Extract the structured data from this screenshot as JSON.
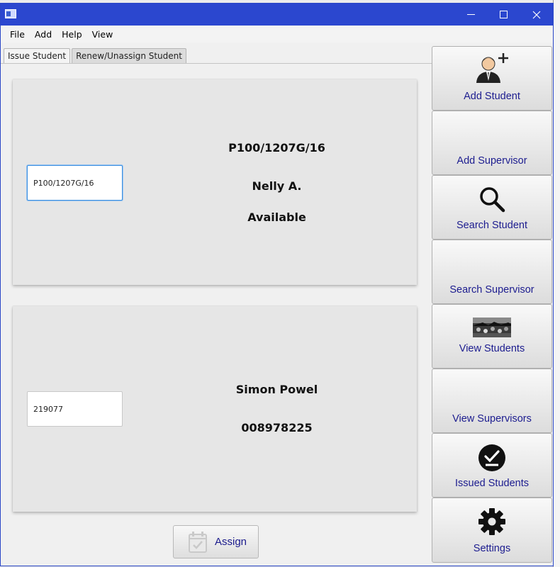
{
  "window": {
    "title": ""
  },
  "menu": [
    "File",
    "Add",
    "Help",
    "View"
  ],
  "tabs": {
    "issue": "Issue Student",
    "renew": "Renew/Unassign Student"
  },
  "issue_panel": {
    "id_input_value": "P100/1207G/16",
    "student_id": "P100/1207G/16",
    "student_name": "Nelly A.",
    "status": "Available"
  },
  "supervisor_panel": {
    "id_input_value": "219077",
    "supervisor_name": "Simon Powel",
    "phone": "008978225"
  },
  "assign_button": {
    "label": "Assign",
    "icon": "calendar-check-icon"
  },
  "sidebar": {
    "add_student": {
      "label": "Add Student",
      "icon": "add-user-icon"
    },
    "add_supervisor": {
      "label": "Add Supervisor"
    },
    "search_student": {
      "label": "Search Student",
      "icon": "search-icon"
    },
    "search_supervisor": {
      "label": "Search Supervisor"
    },
    "view_students": {
      "label": "View Students",
      "icon": "students-photo-icon"
    },
    "view_supervisors": {
      "label": "View Supervisors"
    },
    "issued_students": {
      "label": "Issued Students",
      "icon": "check-circle-icon"
    },
    "settings": {
      "label": "Settings",
      "icon": "gear-icon"
    }
  },
  "colors": {
    "titlebar": "#2b47cf",
    "button_text": "#1c1c8f",
    "focus": "#3d8fe0"
  }
}
